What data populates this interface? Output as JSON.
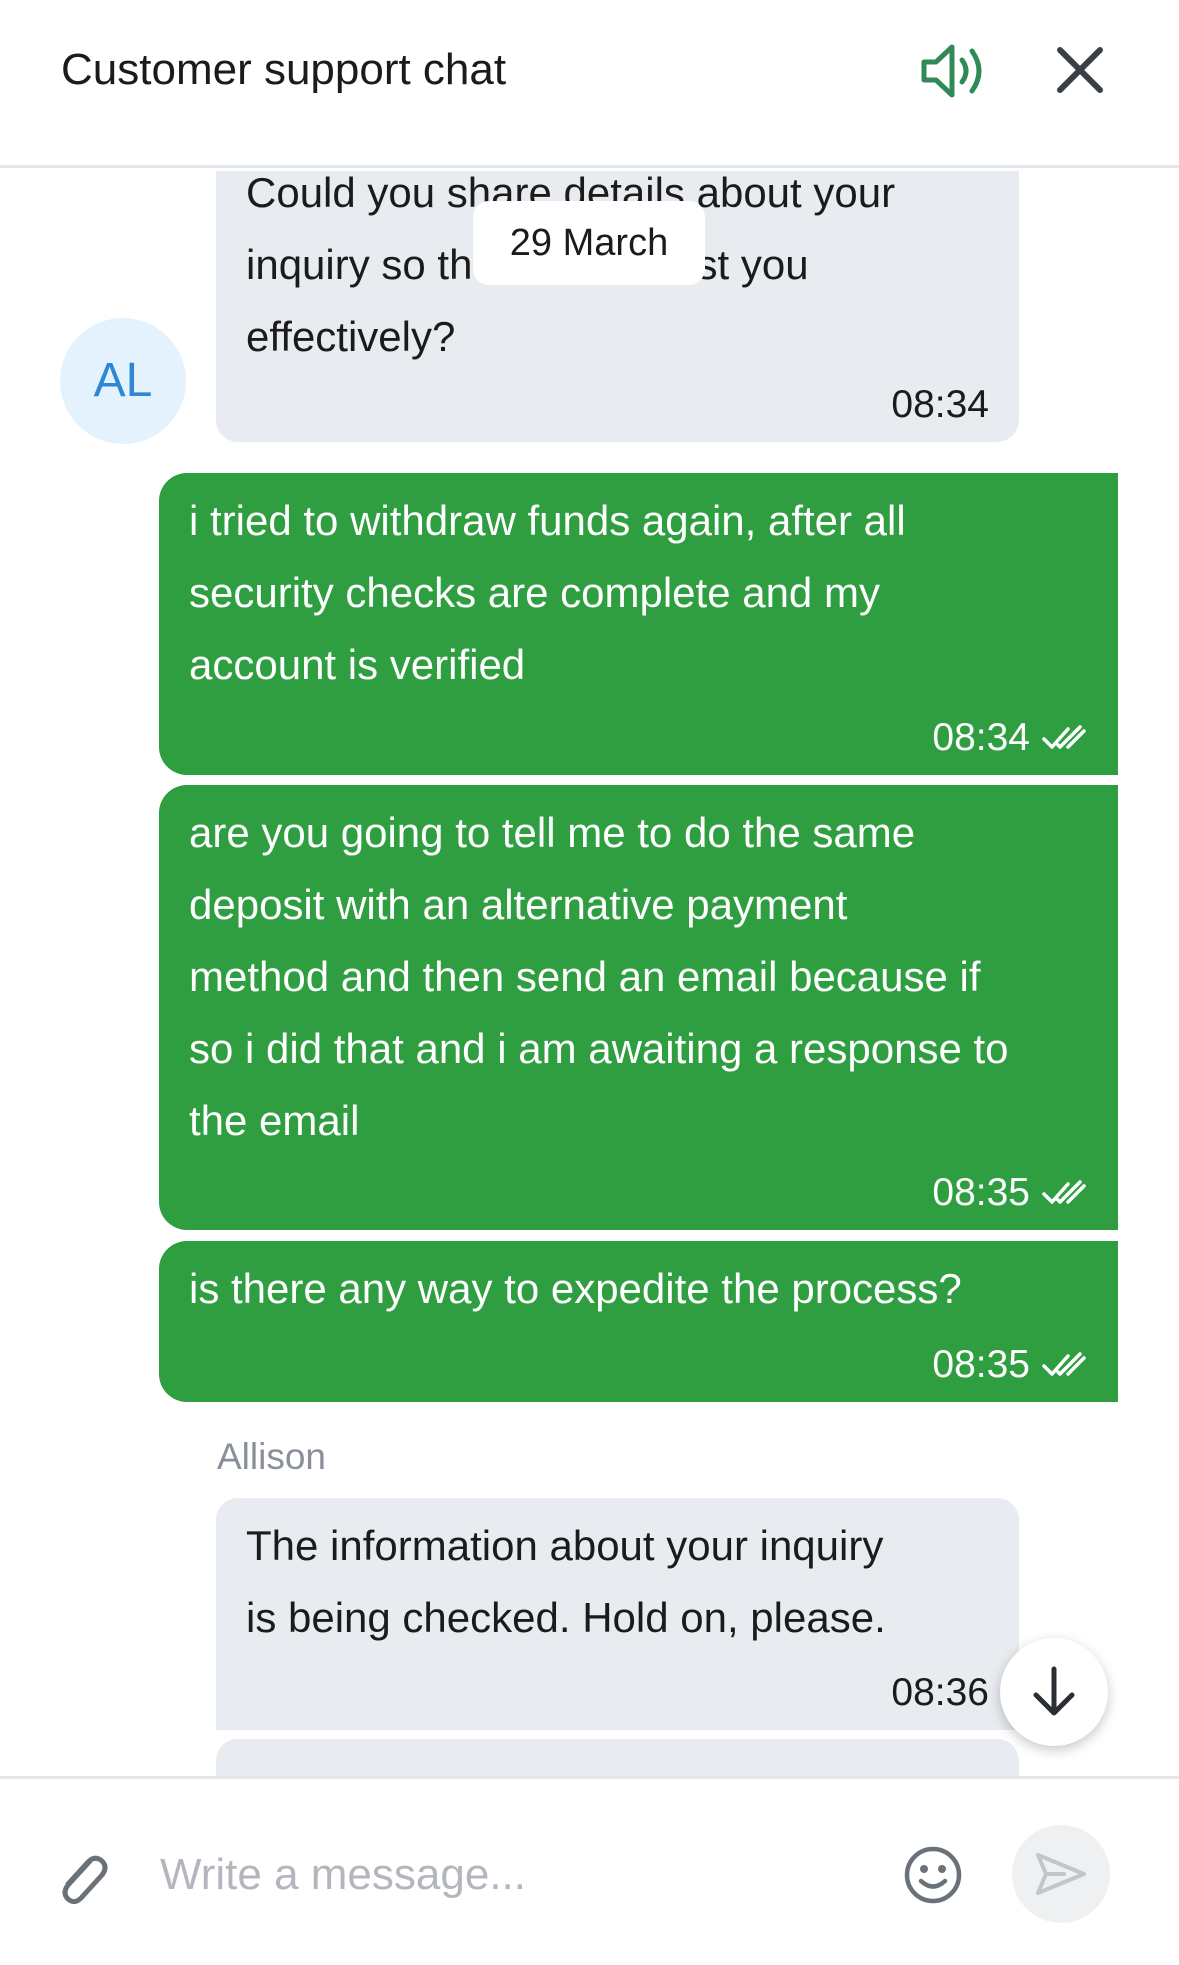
{
  "header": {
    "title": "Customer support chat",
    "sound_icon": "speaker-volume-icon",
    "close_icon": "close-icon",
    "accent_color": "#2f8a57"
  },
  "chat": {
    "date_chip": "29 March",
    "agent_avatar_initials": "AL",
    "messages": [
      {
        "from": "agent",
        "text": "Could you share details about your\ninquiry so that I can assist you\neffectively?",
        "time": "08:34"
      },
      {
        "from": "user",
        "text": "i tried to withdraw funds again, after all\nsecurity checks are complete and my\naccount is verified",
        "time": "08:34",
        "status": "read"
      },
      {
        "from": "user",
        "text": "are you going to tell me to do the same\ndeposit with an alternative payment\nmethod and then send an email because if\nso i did that and i am awaiting a response to\nthe email",
        "time": "08:35",
        "status": "read"
      },
      {
        "from": "user",
        "text": "is there any way to expedite the process?",
        "time": "08:35",
        "status": "read"
      },
      {
        "from": "agent",
        "sender": "Allison",
        "text": "The information about your inquiry\nis being checked. Hold on, please.",
        "time": "08:36"
      }
    ],
    "user_bubble_color": "#2f9e41",
    "agent_bubble_color": "#e8ebef"
  },
  "composer": {
    "placeholder": "Write a message...",
    "attach_icon": "paperclip-icon",
    "emoji_icon": "emoji-smile-icon",
    "send_icon": "send-arrow-icon",
    "scroll_icon": "arrow-down-icon"
  }
}
